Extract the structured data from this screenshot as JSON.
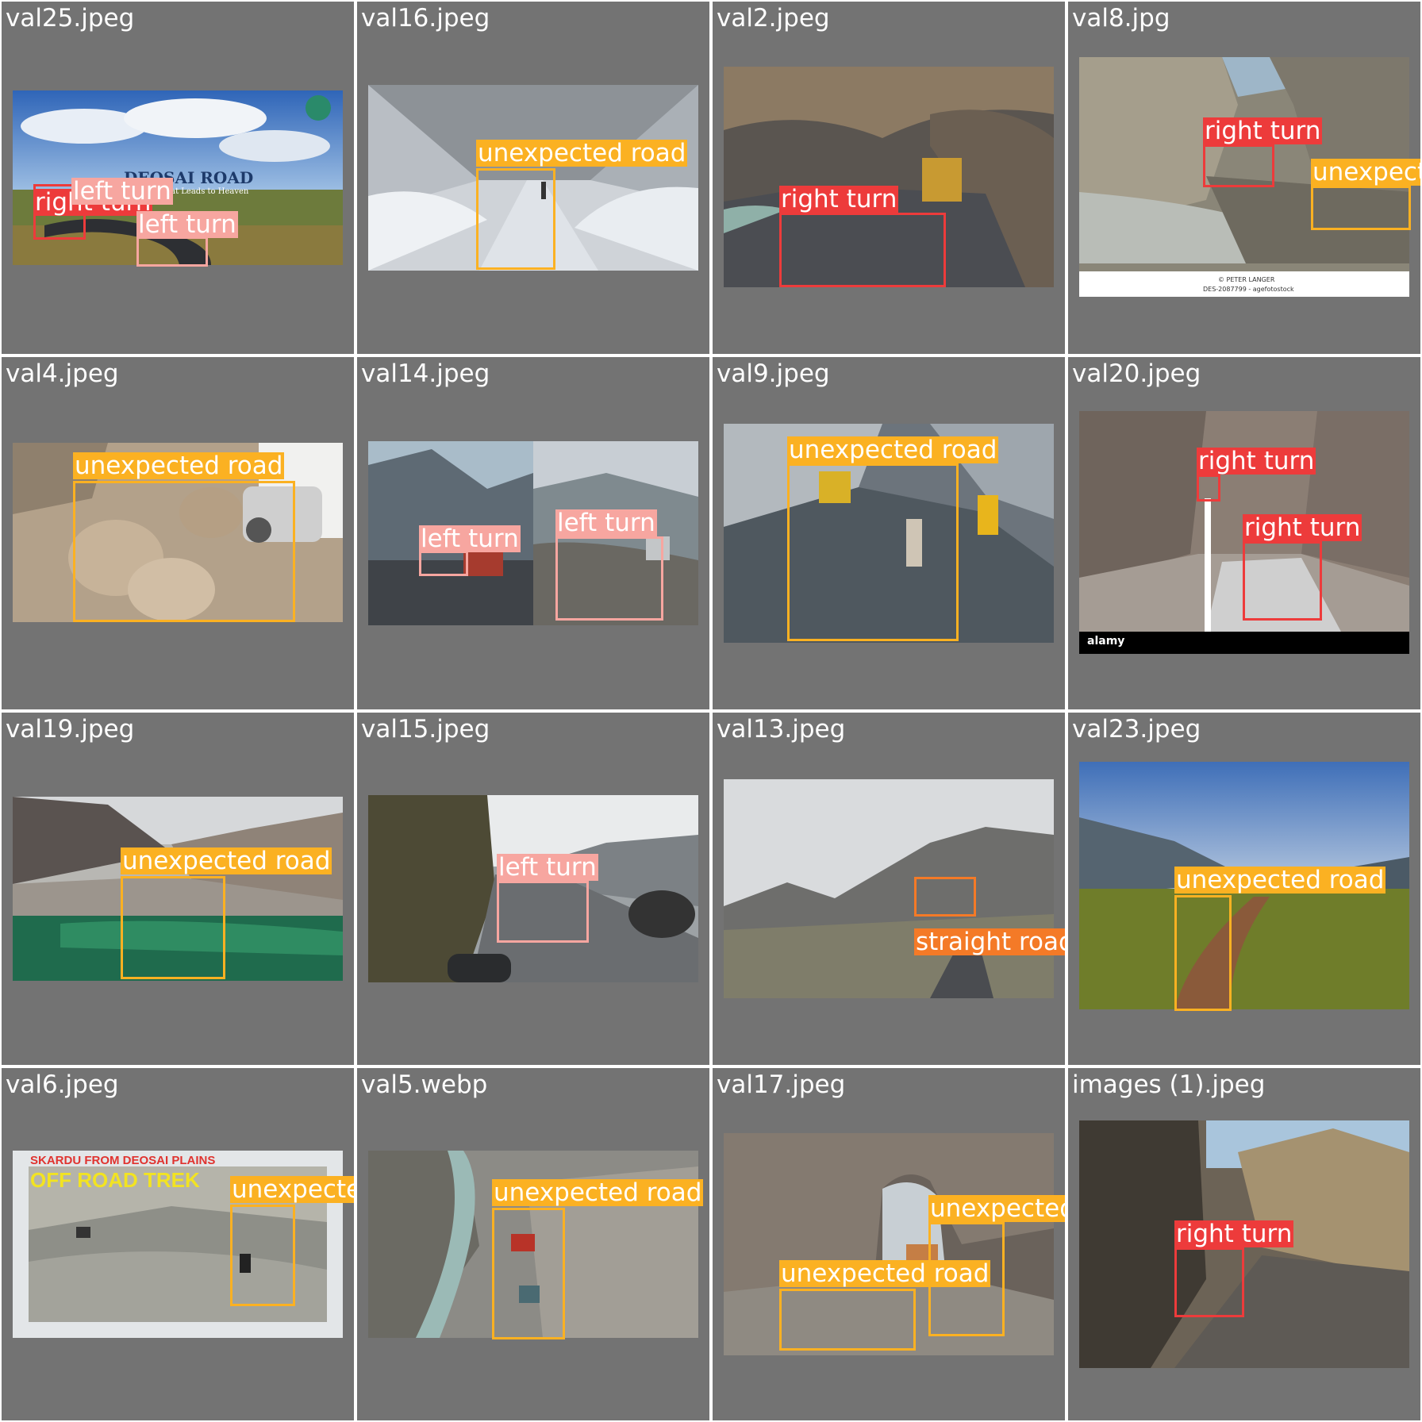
{
  "cells": [
    {
      "filename": "val25.jpeg"
    },
    {
      "filename": "val16.jpeg"
    },
    {
      "filename": "val2.jpeg"
    },
    {
      "filename": "val8.jpg"
    },
    {
      "filename": "val4.jpeg"
    },
    {
      "filename": "val14.jpeg"
    },
    {
      "filename": "val9.jpeg"
    },
    {
      "filename": "val20.jpeg"
    },
    {
      "filename": "val19.jpeg"
    },
    {
      "filename": "val15.jpeg"
    },
    {
      "filename": "val13.jpeg"
    },
    {
      "filename": "val23.jpeg"
    },
    {
      "filename": "val6.jpeg"
    },
    {
      "filename": "val5.webp"
    },
    {
      "filename": "val17.jpeg"
    },
    {
      "filename": "images (1).jpeg"
    }
  ],
  "classes": {
    "right_turn": "right turn",
    "left_turn": "left turn",
    "unexpected_road": "unexpected road",
    "straight_road": "straight road",
    "unexpected_truncated": "unexpect"
  },
  "class_colors": {
    "right turn": "#ed3b3b",
    "left turn": "#f7a6a0",
    "unexpected road": "#fbb122",
    "straight road": "#f47a27"
  },
  "photo_text": {
    "val25_title": "DEOSAI ROAD",
    "val25_subtitle": "That Leads to Heaven",
    "val8_credit_1": "© PETER LANGER",
    "val8_credit_2": "DES-2087799 - agefotostock",
    "val20_brand": "alamy",
    "val6_title_1": "SKARDU FROM DEOSAI PLAINS",
    "val6_title_2": "OFF ROAD TREK"
  }
}
